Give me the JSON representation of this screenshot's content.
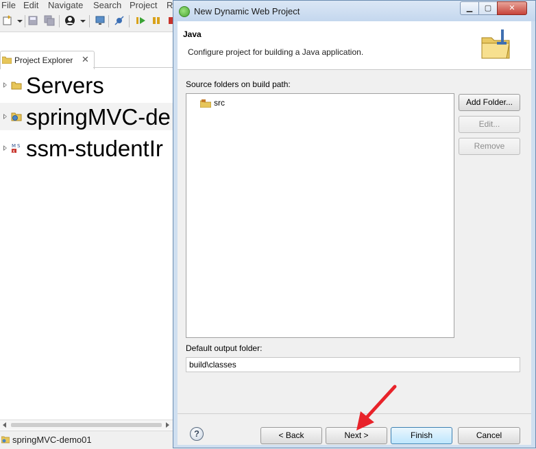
{
  "ide": {
    "menu": [
      "File",
      "Edit",
      "Navigate",
      "Search",
      "Project",
      "R"
    ],
    "project_explorer_tab": "Project Explorer",
    "tree_items": [
      {
        "label": "Servers",
        "icon": "folder-icon"
      },
      {
        "label": "springMVC-de",
        "icon": "web-project-icon",
        "selected": true
      },
      {
        "label": "ssm-studentIr",
        "icon": "maven-project-icon"
      }
    ],
    "status_text": "springMVC-demo01"
  },
  "dialog": {
    "title": "New Dynamic Web Project",
    "page_title": "Java",
    "page_description": "Configure project for building a Java application.",
    "source_folders_label": "Source folders on build path:",
    "source_folders": [
      "src"
    ],
    "add_folder_label": "Add Folder...",
    "edit_label": "Edit...",
    "remove_label": "Remove",
    "output_folder_label": "Default output folder:",
    "output_folder_value": "build\\classes",
    "back_label": "< Back",
    "next_label": "Next >",
    "finish_label": "Finish",
    "cancel_label": "Cancel",
    "help_label": "?"
  },
  "colors": {
    "annotation_arrow": "#e8232a",
    "dialog_frame": "#cfdff0"
  }
}
